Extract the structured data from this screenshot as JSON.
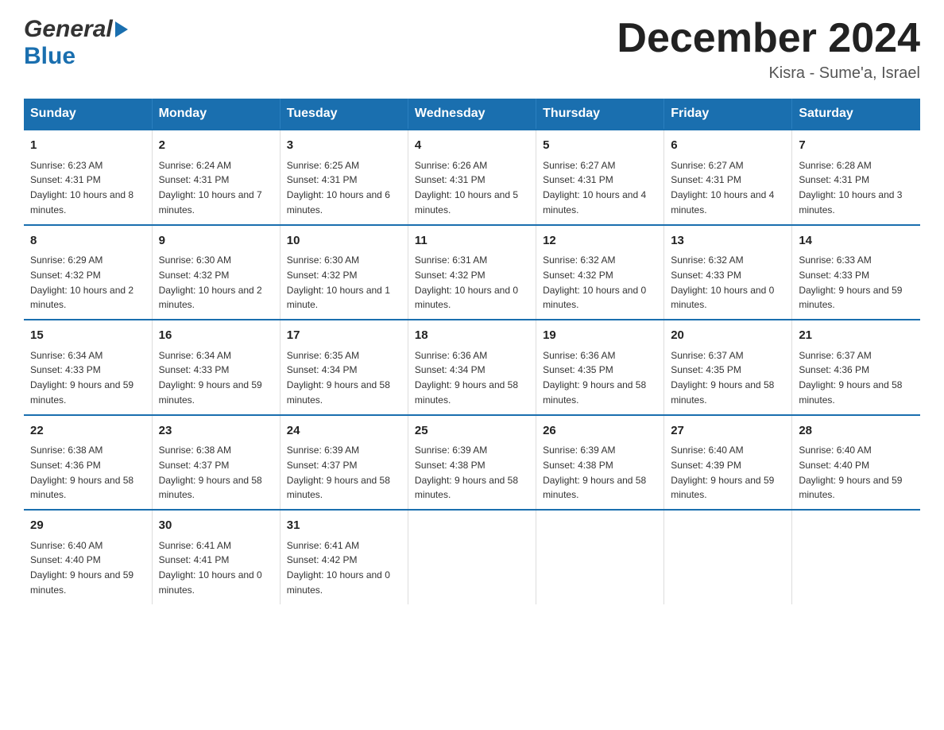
{
  "logo": {
    "general_text": "General",
    "blue_text": "Blue",
    "brand_color": "#1a6faf"
  },
  "header": {
    "title": "December 2024",
    "location": "Kisra - Sume'a, Israel"
  },
  "weekdays": [
    "Sunday",
    "Monday",
    "Tuesday",
    "Wednesday",
    "Thursday",
    "Friday",
    "Saturday"
  ],
  "weeks": [
    [
      {
        "day": "1",
        "sunrise": "6:23 AM",
        "sunset": "4:31 PM",
        "daylight": "10 hours and 8 minutes."
      },
      {
        "day": "2",
        "sunrise": "6:24 AM",
        "sunset": "4:31 PM",
        "daylight": "10 hours and 7 minutes."
      },
      {
        "day": "3",
        "sunrise": "6:25 AM",
        "sunset": "4:31 PM",
        "daylight": "10 hours and 6 minutes."
      },
      {
        "day": "4",
        "sunrise": "6:26 AM",
        "sunset": "4:31 PM",
        "daylight": "10 hours and 5 minutes."
      },
      {
        "day": "5",
        "sunrise": "6:27 AM",
        "sunset": "4:31 PM",
        "daylight": "10 hours and 4 minutes."
      },
      {
        "day": "6",
        "sunrise": "6:27 AM",
        "sunset": "4:31 PM",
        "daylight": "10 hours and 4 minutes."
      },
      {
        "day": "7",
        "sunrise": "6:28 AM",
        "sunset": "4:31 PM",
        "daylight": "10 hours and 3 minutes."
      }
    ],
    [
      {
        "day": "8",
        "sunrise": "6:29 AM",
        "sunset": "4:32 PM",
        "daylight": "10 hours and 2 minutes."
      },
      {
        "day": "9",
        "sunrise": "6:30 AM",
        "sunset": "4:32 PM",
        "daylight": "10 hours and 2 minutes."
      },
      {
        "day": "10",
        "sunrise": "6:30 AM",
        "sunset": "4:32 PM",
        "daylight": "10 hours and 1 minute."
      },
      {
        "day": "11",
        "sunrise": "6:31 AM",
        "sunset": "4:32 PM",
        "daylight": "10 hours and 0 minutes."
      },
      {
        "day": "12",
        "sunrise": "6:32 AM",
        "sunset": "4:32 PM",
        "daylight": "10 hours and 0 minutes."
      },
      {
        "day": "13",
        "sunrise": "6:32 AM",
        "sunset": "4:33 PM",
        "daylight": "10 hours and 0 minutes."
      },
      {
        "day": "14",
        "sunrise": "6:33 AM",
        "sunset": "4:33 PM",
        "daylight": "9 hours and 59 minutes."
      }
    ],
    [
      {
        "day": "15",
        "sunrise": "6:34 AM",
        "sunset": "4:33 PM",
        "daylight": "9 hours and 59 minutes."
      },
      {
        "day": "16",
        "sunrise": "6:34 AM",
        "sunset": "4:33 PM",
        "daylight": "9 hours and 59 minutes."
      },
      {
        "day": "17",
        "sunrise": "6:35 AM",
        "sunset": "4:34 PM",
        "daylight": "9 hours and 58 minutes."
      },
      {
        "day": "18",
        "sunrise": "6:36 AM",
        "sunset": "4:34 PM",
        "daylight": "9 hours and 58 minutes."
      },
      {
        "day": "19",
        "sunrise": "6:36 AM",
        "sunset": "4:35 PM",
        "daylight": "9 hours and 58 minutes."
      },
      {
        "day": "20",
        "sunrise": "6:37 AM",
        "sunset": "4:35 PM",
        "daylight": "9 hours and 58 minutes."
      },
      {
        "day": "21",
        "sunrise": "6:37 AM",
        "sunset": "4:36 PM",
        "daylight": "9 hours and 58 minutes."
      }
    ],
    [
      {
        "day": "22",
        "sunrise": "6:38 AM",
        "sunset": "4:36 PM",
        "daylight": "9 hours and 58 minutes."
      },
      {
        "day": "23",
        "sunrise": "6:38 AM",
        "sunset": "4:37 PM",
        "daylight": "9 hours and 58 minutes."
      },
      {
        "day": "24",
        "sunrise": "6:39 AM",
        "sunset": "4:37 PM",
        "daylight": "9 hours and 58 minutes."
      },
      {
        "day": "25",
        "sunrise": "6:39 AM",
        "sunset": "4:38 PM",
        "daylight": "9 hours and 58 minutes."
      },
      {
        "day": "26",
        "sunrise": "6:39 AM",
        "sunset": "4:38 PM",
        "daylight": "9 hours and 58 minutes."
      },
      {
        "day": "27",
        "sunrise": "6:40 AM",
        "sunset": "4:39 PM",
        "daylight": "9 hours and 59 minutes."
      },
      {
        "day": "28",
        "sunrise": "6:40 AM",
        "sunset": "4:40 PM",
        "daylight": "9 hours and 59 minutes."
      }
    ],
    [
      {
        "day": "29",
        "sunrise": "6:40 AM",
        "sunset": "4:40 PM",
        "daylight": "9 hours and 59 minutes."
      },
      {
        "day": "30",
        "sunrise": "6:41 AM",
        "sunset": "4:41 PM",
        "daylight": "10 hours and 0 minutes."
      },
      {
        "day": "31",
        "sunrise": "6:41 AM",
        "sunset": "4:42 PM",
        "daylight": "10 hours and 0 minutes."
      },
      null,
      null,
      null,
      null
    ]
  ]
}
